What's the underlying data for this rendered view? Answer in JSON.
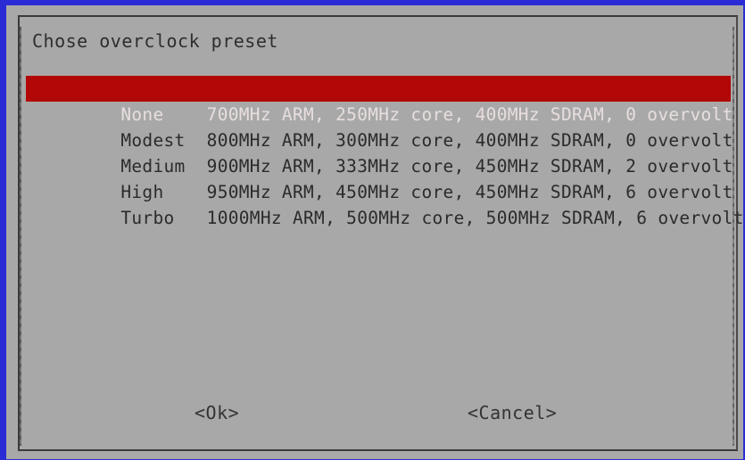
{
  "dialog": {
    "title": "Chose overclock preset",
    "background_color": "#a8a8a8",
    "screen_color": "#2b2bd6",
    "highlight_color": "#b20707"
  },
  "menu": {
    "selected_index": 0,
    "items": [
      {
        "name": "None",
        "text": "None    700MHz ARM, 250MHz core, 400MHz SDRAM, 0 overvolt"
      },
      {
        "name": "Modest",
        "text": "Modest  800MHz ARM, 300MHz core, 400MHz SDRAM, 0 overvolt"
      },
      {
        "name": "Medium",
        "text": "Medium  900MHz ARM, 333MHz core, 450MHz SDRAM, 2 overvolt"
      },
      {
        "name": "High",
        "text": "High    950MHz ARM, 450MHz core, 450MHz SDRAM, 6 overvolt"
      },
      {
        "name": "Turbo",
        "text": "Turbo   1000MHz ARM, 500MHz core, 500MHz SDRAM, 6 overvolt"
      }
    ]
  },
  "buttons": {
    "ok": "<Ok>",
    "cancel": "<Cancel>"
  }
}
